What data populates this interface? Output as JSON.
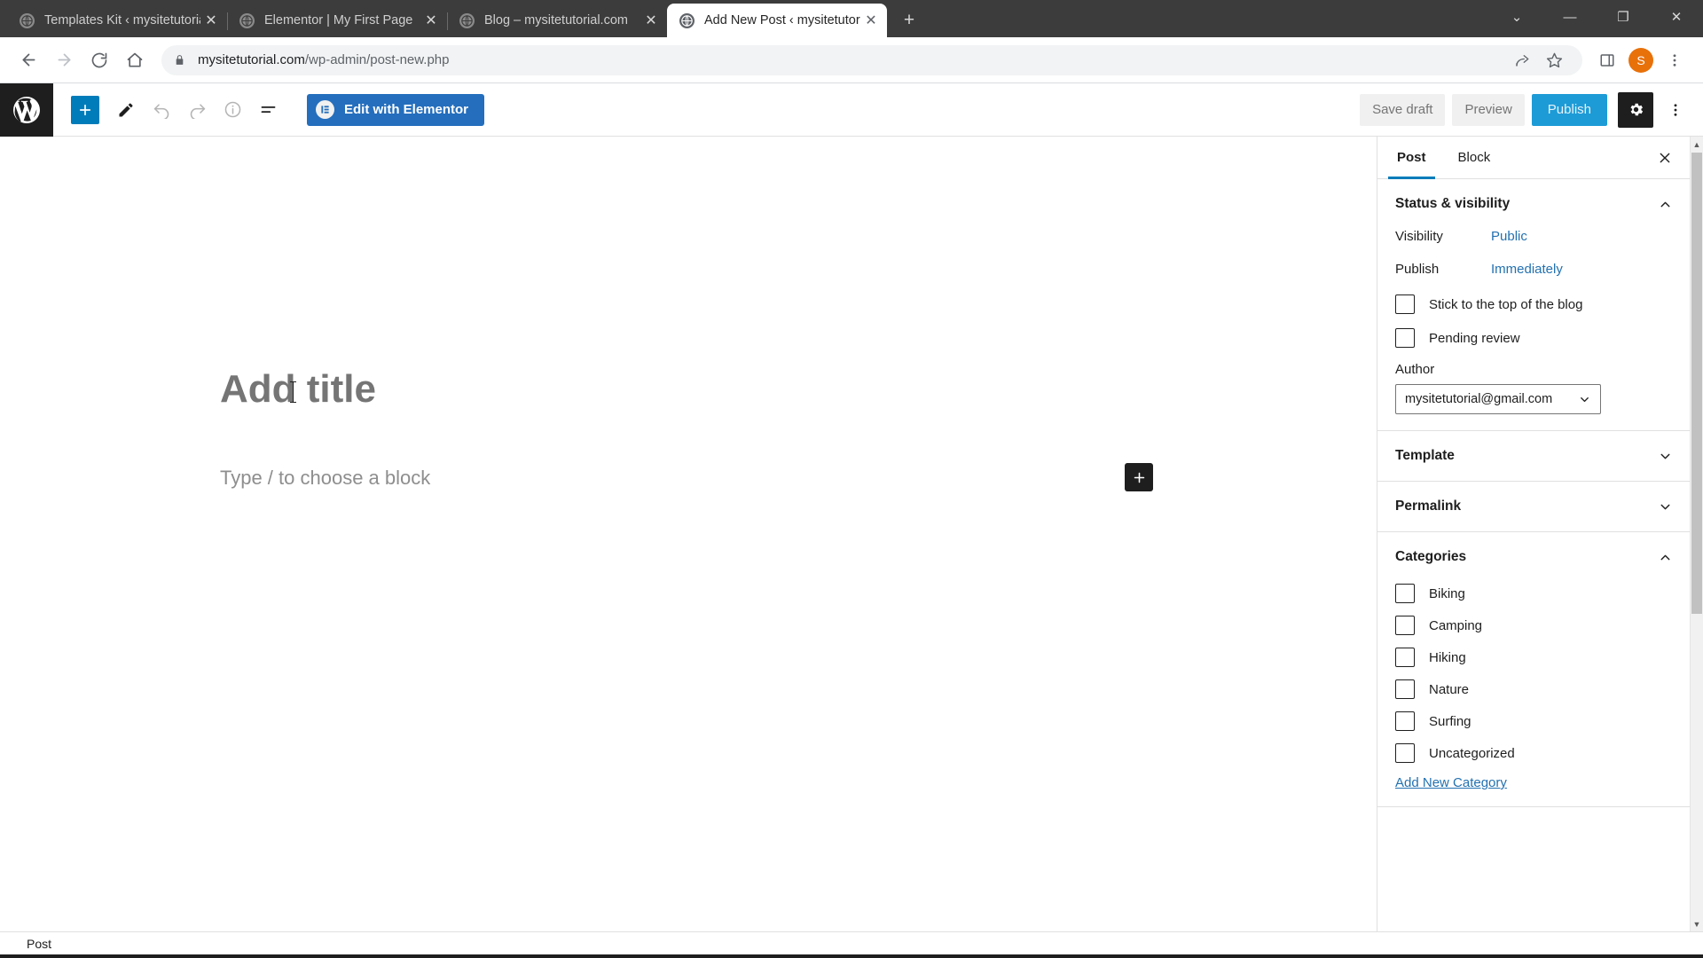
{
  "browser": {
    "tabs": [
      {
        "title": "Templates Kit ‹ mysitetutorial.com",
        "favicon": "globe-icon",
        "active": false
      },
      {
        "title": "Elementor | My First Page",
        "favicon": "globe-icon",
        "active": false
      },
      {
        "title": "Blog – mysitetutorial.com",
        "favicon": "globe-icon",
        "active": false
      },
      {
        "title": "Add New Post ‹ mysitetutorial.co",
        "favicon": "globe-icon",
        "active": true
      }
    ],
    "new_tab_label": "+",
    "window_controls": {
      "minimize_tabs": "⌄",
      "minimize": "—",
      "maximize": "❐",
      "close": "✕"
    },
    "nav": {
      "back": "back-icon",
      "forward": "forward-icon",
      "reload": "reload-icon",
      "home": "home-icon"
    },
    "address": {
      "lock": "lock-icon",
      "host": "mysitetutorial.com",
      "path": "/wp-admin/post-new.php"
    },
    "actions": {
      "share": "share-icon",
      "bookmark": "star-icon",
      "side_panel": "side-panel-icon",
      "avatar_initial": "S",
      "menu": "kebab-icon"
    }
  },
  "wp_header": {
    "logo": "wordpress-logo",
    "inserter_label": "+",
    "tools": {
      "edit": "pencil-icon",
      "undo": "undo-icon",
      "redo": "redo-icon",
      "details": "info-icon",
      "list_view": "list-view-icon"
    },
    "elementor_button": "Edit with Elementor",
    "save_draft": "Save draft",
    "preview": "Preview",
    "publish": "Publish",
    "settings_icon": "gear-icon",
    "more_icon": "kebab-icon"
  },
  "editor": {
    "title_placeholder": "Add title",
    "block_placeholder": "Type / to choose a block",
    "inline_inserter": "+"
  },
  "sidebar": {
    "tabs": [
      {
        "label": "Post",
        "active": true
      },
      {
        "label": "Block",
        "active": false
      }
    ],
    "close_icon": "close-icon",
    "panels": [
      {
        "title": "Status & visibility",
        "expanded": true,
        "rows": [
          {
            "label": "Visibility",
            "value": "Public"
          },
          {
            "label": "Publish",
            "value": "Immediately"
          }
        ],
        "checkboxes": [
          {
            "label": "Stick to the top of the blog",
            "checked": false
          },
          {
            "label": "Pending review",
            "checked": false
          }
        ],
        "author_label": "Author",
        "author_value": "mysitetutorial@gmail.com"
      },
      {
        "title": "Template",
        "expanded": false
      },
      {
        "title": "Permalink",
        "expanded": false
      },
      {
        "title": "Categories",
        "expanded": true,
        "categories": [
          {
            "label": "Biking",
            "checked": false
          },
          {
            "label": "Camping",
            "checked": false
          },
          {
            "label": "Hiking",
            "checked": false
          },
          {
            "label": "Nature",
            "checked": false
          },
          {
            "label": "Surfing",
            "checked": false
          },
          {
            "label": "Uncategorized",
            "checked": false
          }
        ],
        "add_link": "Add New Category"
      }
    ]
  },
  "statusbar": {
    "breadcrumb": "Post"
  },
  "colors": {
    "wp_blue": "#007cba",
    "publish_blue": "#1d9bd7",
    "elementor_blue": "#246ebd",
    "link_blue": "#2271b1",
    "avatar_orange": "#e8710a"
  }
}
